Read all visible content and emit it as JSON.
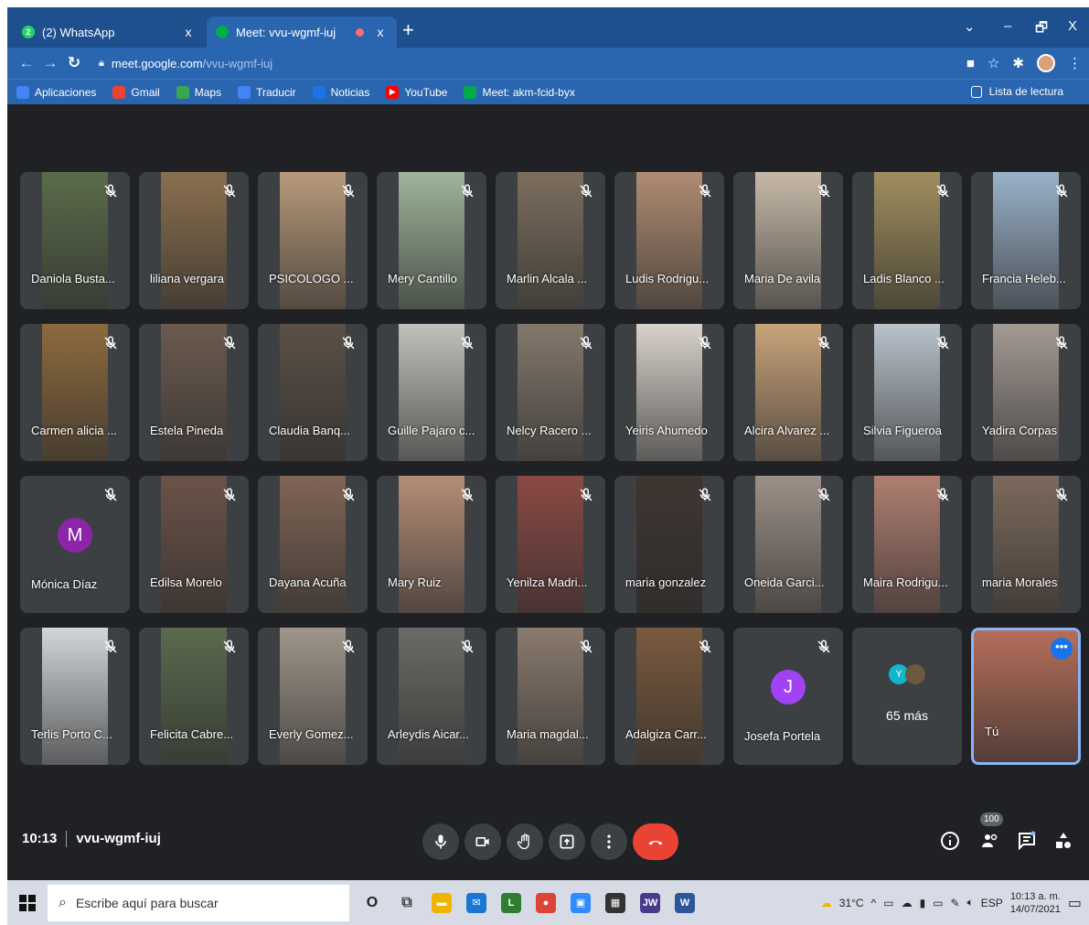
{
  "browser": {
    "tabs": [
      {
        "title": "(2) WhatsApp",
        "close": "x",
        "favicon_color": "#25d366",
        "badge": "2"
      },
      {
        "title": "Meet: vvu-wgmf-iuj",
        "close": "x",
        "favicon_color": "#00ac47"
      }
    ],
    "new_tab": "+",
    "window_controls": [
      "–",
      "🗗",
      "X"
    ],
    "url_host": "meet.google.com",
    "url_path": "/vvu-wgmf-iuj",
    "bookmarks": [
      {
        "label": "Aplicaciones",
        "color": "#4285f4"
      },
      {
        "label": "Gmail",
        "color": "#ea4335"
      },
      {
        "label": "Maps",
        "color": "#34a853"
      },
      {
        "label": "Traducir",
        "color": "#4285f4"
      },
      {
        "label": "Noticias",
        "color": "#1a73e8"
      },
      {
        "label": "YouTube",
        "color": "#ff0000"
      },
      {
        "label": "Meet: akm-fcid-byx",
        "color": "#00ac47"
      }
    ],
    "reading_list": "Lista de lectura"
  },
  "meet": {
    "time": "10:13",
    "code": "vvu-wgmf-iuj",
    "participant_count": "100",
    "participants": [
      {
        "name": "Daniola Busta...",
        "bg": "#5a6b4a"
      },
      {
        "name": "liliana vergara",
        "bg": "#8a6f4e"
      },
      {
        "name": "PSICOLOGO ...",
        "bg": "#b89a7a"
      },
      {
        "name": "Mery Cantillo",
        "bg": "#9fb59a"
      },
      {
        "name": "Marlin Alcala ...",
        "bg": "#7c6e5e"
      },
      {
        "name": "Ludis Rodrigu...",
        "bg": "#b08c72"
      },
      {
        "name": "Maria De avila",
        "bg": "#c7b9a8"
      },
      {
        "name": "Ladis Blanco ...",
        "bg": "#a08e5e"
      },
      {
        "name": "Francia Heleb...",
        "bg": "#9ab2c9"
      },
      {
        "name": "Carmen alicia ...",
        "bg": "#8e6a3e"
      },
      {
        "name": "Estela Pineda",
        "bg": "#6b5a4f"
      },
      {
        "name": "Claudia Banq...",
        "bg": "#5b5046"
      },
      {
        "name": "Guille Pajaro c...",
        "bg": "#c2c2bc"
      },
      {
        "name": "Nelcy Racero ...",
        "bg": "#84786c"
      },
      {
        "name": "Yeiris Ahumedo",
        "bg": "#d9d2cb"
      },
      {
        "name": "Alcira Alvarez ...",
        "bg": "#c9a47a"
      },
      {
        "name": "Silvia Figueroa",
        "bg": "#b9c3cc"
      },
      {
        "name": "Yadira Corpas",
        "bg": "#a49a94"
      },
      {
        "name": "Mónica Díaz",
        "avatar": "M",
        "avatar_color": "#8e24aa"
      },
      {
        "name": "Edilsa Morelo",
        "bg": "#6b5348"
      },
      {
        "name": "Dayana Acuña",
        "bg": "#806455"
      },
      {
        "name": "Mary Ruiz",
        "bg": "#b48e76"
      },
      {
        "name": "Yenilza Madri...",
        "bg": "#8b4a44"
      },
      {
        "name": "maria gonzalez",
        "bg": "#3e3531"
      },
      {
        "name": "Oneida Garci...",
        "bg": "#9c9087"
      },
      {
        "name": "Maira Rodrigu...",
        "bg": "#b07e71"
      },
      {
        "name": "maria Morales",
        "bg": "#7c6a5c"
      },
      {
        "name": "Terlis Porto C...",
        "bg": "#d2d6da"
      },
      {
        "name": "Felicita Cabre...",
        "bg": "#5a6a4e"
      },
      {
        "name": "Everly Gomez...",
        "bg": "#a0968a"
      },
      {
        "name": "Arleydis Aicar...",
        "bg": "#6a6a66"
      },
      {
        "name": "Maria magdal...",
        "bg": "#8a7a6e"
      },
      {
        "name": "Adalgiza Carr...",
        "bg": "#7a5a3e"
      },
      {
        "name": "Josefa Portela",
        "avatar": "J",
        "avatar_color": "#a142f4"
      },
      {
        "name": "",
        "more": "65 más"
      },
      {
        "name": "Tú",
        "bg": "#b56e5a",
        "self": true
      }
    ]
  },
  "taskbar": {
    "search_placeholder": "Escribe aquí para buscar",
    "apps": [
      {
        "name": "cortana",
        "glyph": "O",
        "color": "#222"
      },
      {
        "name": "task-view",
        "glyph": "⧉",
        "color": "#444"
      },
      {
        "name": "file-explorer",
        "glyph": "▬",
        "color": "#f0b400"
      },
      {
        "name": "mail",
        "glyph": "✉",
        "color": "#1976d2"
      },
      {
        "name": "app-l",
        "glyph": "L",
        "color": "#2e7d32"
      },
      {
        "name": "chrome",
        "glyph": "●",
        "color": "#db4437"
      },
      {
        "name": "zoom",
        "glyph": "▣",
        "color": "#2d8cff"
      },
      {
        "name": "store",
        "glyph": "▦",
        "color": "#333"
      },
      {
        "name": "jw",
        "glyph": "JW",
        "color": "#4a3a8c"
      },
      {
        "name": "word",
        "glyph": "W",
        "color": "#2b579a"
      }
    ],
    "weather": "31°C",
    "language": "ESP",
    "clock_time": "10:13 a. m.",
    "clock_date": "14/07/2021"
  }
}
